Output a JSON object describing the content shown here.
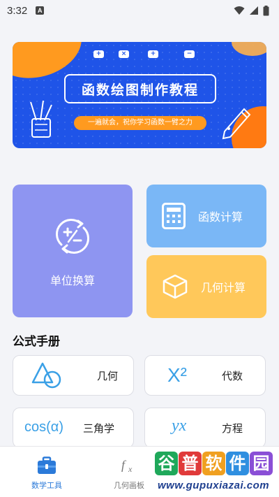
{
  "status_bar": {
    "time": "3:32",
    "notification_badge": "A"
  },
  "banner": {
    "title": "函数绘图制作教程",
    "subtitle": "一遍就会，祝你学习函数一臂之力",
    "op_icons": [
      "+",
      "×",
      "+",
      "−"
    ],
    "colors": {
      "background": "#1f54e8",
      "accent": "#ff9a1f"
    }
  },
  "tools": {
    "unit_conversion": {
      "label": "单位换算",
      "color": "#8e95f1"
    },
    "function_calc": {
      "label": "函数计算",
      "color": "#7ab7f6"
    },
    "geometry_calc": {
      "label": "几何计算",
      "color": "#ffc85a"
    }
  },
  "formula_manual": {
    "title": "公式手册",
    "items": [
      {
        "label": "几何",
        "symbol": ""
      },
      {
        "label": "代数",
        "symbol": "X²"
      },
      {
        "label": "三角学",
        "symbol": "cos(α)"
      },
      {
        "label": "方程",
        "symbol": "yx"
      }
    ]
  },
  "bottom_nav": {
    "items": [
      {
        "label": "数学工具",
        "active": true
      },
      {
        "label": "几何画板",
        "active": false
      }
    ],
    "active_color": "#2b7ad9"
  },
  "watermark": {
    "chars": [
      "谷",
      "普",
      "软",
      "件",
      "园"
    ],
    "url": "www.gupuxiazai.com"
  }
}
